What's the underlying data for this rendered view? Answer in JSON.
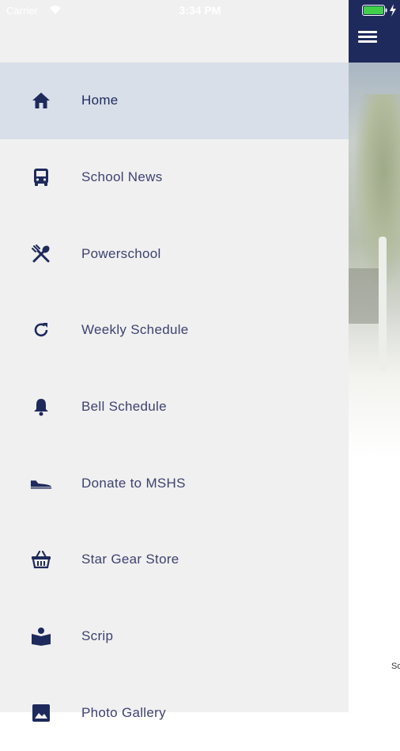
{
  "status_bar": {
    "carrier": "Carrier",
    "time": "3:34 PM"
  },
  "drawer": {
    "items": [
      {
        "label": "Home",
        "icon": "home-icon",
        "active": true
      },
      {
        "label": "School News",
        "icon": "bus-icon"
      },
      {
        "label": "Powerschool",
        "icon": "utensils-icon"
      },
      {
        "label": "Weekly Schedule",
        "icon": "refresh-icon"
      },
      {
        "label": "Bell Schedule",
        "icon": "bell-icon"
      },
      {
        "label": "Donate to MSHS",
        "icon": "shoe-icon"
      },
      {
        "label": "Star Gear Store",
        "icon": "basket-icon"
      },
      {
        "label": "Scrip",
        "icon": "reader-icon"
      },
      {
        "label": "Photo Gallery",
        "icon": "image-icon"
      }
    ]
  },
  "main": {
    "caption": "Sc"
  },
  "colors": {
    "header": "#1e2a5c",
    "drawer_bg": "#f0f0f0",
    "active_item_bg": "#d8dfe9",
    "icon": "#1e2a5c",
    "label": "#3d4270"
  }
}
